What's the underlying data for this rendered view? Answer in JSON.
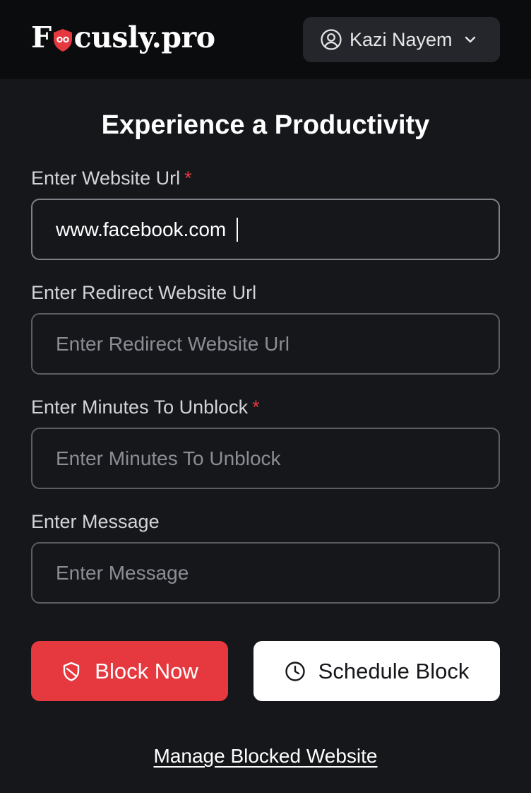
{
  "header": {
    "logo_text_start": "F",
    "logo_text_end": "cusly.pro",
    "user_name": "Kazi Nayem"
  },
  "form": {
    "title": "Experience a Productivity",
    "website_url": {
      "label": "Enter Website Url",
      "required_mark": "*",
      "value": "www.facebook.com",
      "placeholder": ""
    },
    "redirect_url": {
      "label": "Enter Redirect Website Url",
      "value": "",
      "placeholder": "Enter Redirect Website Url"
    },
    "minutes": {
      "label": "Enter Minutes To Unblock",
      "required_mark": "*",
      "value": "",
      "placeholder": "Enter Minutes To Unblock"
    },
    "message": {
      "label": "Enter Message",
      "value": "",
      "placeholder": "Enter Message"
    }
  },
  "actions": {
    "block_now_label": "Block Now",
    "schedule_block_label": "Schedule Block",
    "manage_link_label": "Manage Blocked Website"
  },
  "icons": {
    "logo_mark": "focus-shield-icon",
    "user": "user-circle-icon",
    "dropdown": "chevron-down-icon",
    "block": "shield-slash-icon",
    "schedule": "clock-icon"
  },
  "colors": {
    "background": "#15171b",
    "header": "#0b0c0e",
    "accent_red": "#e5383f",
    "input_border": "#5b5e64"
  }
}
